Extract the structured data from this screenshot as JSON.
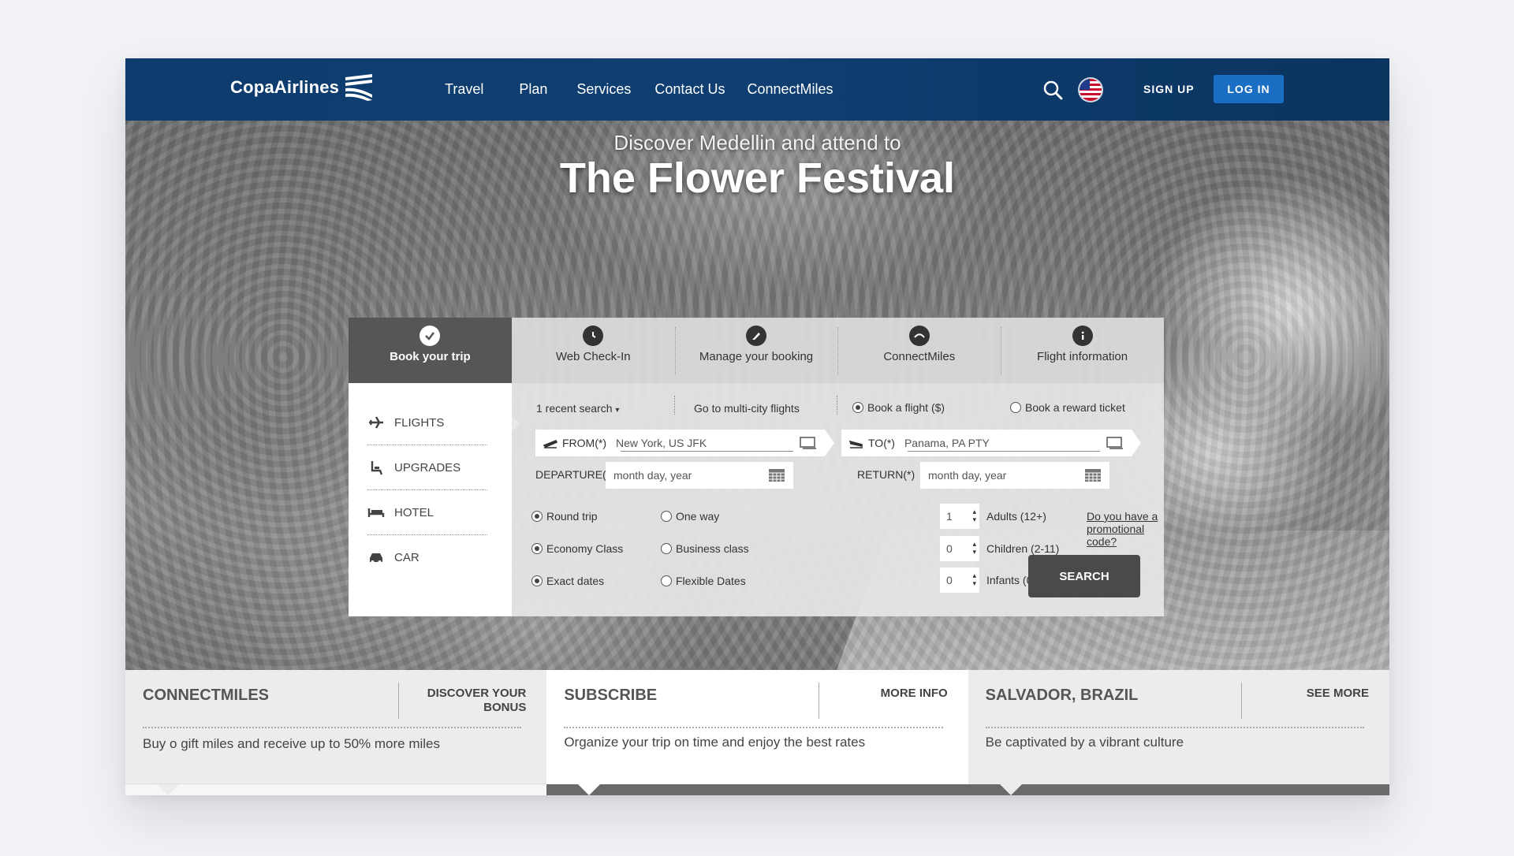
{
  "brand": {
    "name": "CopaAirlines"
  },
  "nav": {
    "items": [
      "Travel",
      "Plan",
      "Services",
      "Contact Us",
      "ConnectMiles"
    ],
    "signup_label": "SIGN UP",
    "login_label": "LOG IN"
  },
  "hero": {
    "subtitle": "Discover Medellin and attend to",
    "title": "The Flower Festival"
  },
  "booking": {
    "tabs": [
      {
        "label": "Book your trip",
        "icon": "check-icon",
        "active": true
      },
      {
        "label": "Web Check-In",
        "icon": "clock-icon",
        "active": false
      },
      {
        "label": "Manage your booking",
        "icon": "pencil-icon",
        "active": false
      },
      {
        "label": "ConnectMiles",
        "icon": "connectmiles-icon",
        "active": false
      },
      {
        "label": "Flight information",
        "icon": "info-icon",
        "active": false
      }
    ],
    "side_items": [
      {
        "label": "FLIGHTS",
        "icon": "plane-icon"
      },
      {
        "label": "UPGRADES",
        "icon": "seat-icon"
      },
      {
        "label": "HOTEL",
        "icon": "bed-icon"
      },
      {
        "label": "CAR",
        "icon": "car-icon"
      }
    ],
    "recent_search": "1 recent search",
    "multi_city": "Go to multi-city flights",
    "book_flight": "Book a flight ($)",
    "book_reward": "Book a reward ticket",
    "from_label": "FROM(*)",
    "from_value": "New York, US JFK",
    "to_label": "TO(*)",
    "to_value": "Panama, PA PTY",
    "departure_label": "DEPARTURE(*)",
    "departure_placeholder": "month day, year",
    "return_label": "RETURN(*)",
    "return_placeholder": "month day, year",
    "round_trip": "Round trip",
    "one_way": "One way",
    "economy": "Economy Class",
    "business": "Business class",
    "exact_dates": "Exact dates",
    "flexible_dates": "Flexible Dates",
    "adults_value": "1",
    "adults_label": "Adults (12+)",
    "children_value": "0",
    "children_label": "Children (2-11)",
    "infants_value": "0",
    "infants_label": "Infants (0-1)",
    "promo_label": "Do you have a promotional code?",
    "search_label": "SEARCH"
  },
  "promos": [
    {
      "title": "CONNECTMILES",
      "link": "DISCOVER YOUR BONUS",
      "text": "Buy o gift miles and receive up to 50% more miles"
    },
    {
      "title": "SUBSCRIBE",
      "link": "MORE INFO",
      "text": "Organize your trip on time and enjoy the best rates"
    },
    {
      "title": "SALVADOR, BRAZIL",
      "link": "SEE MORE",
      "text": "Be captivated by a vibrant culture"
    }
  ],
  "colors": {
    "header": "#0f3e72",
    "login_button": "#1a6fc4",
    "search_button": "#4a4a4a",
    "active_tab": "#565656"
  }
}
